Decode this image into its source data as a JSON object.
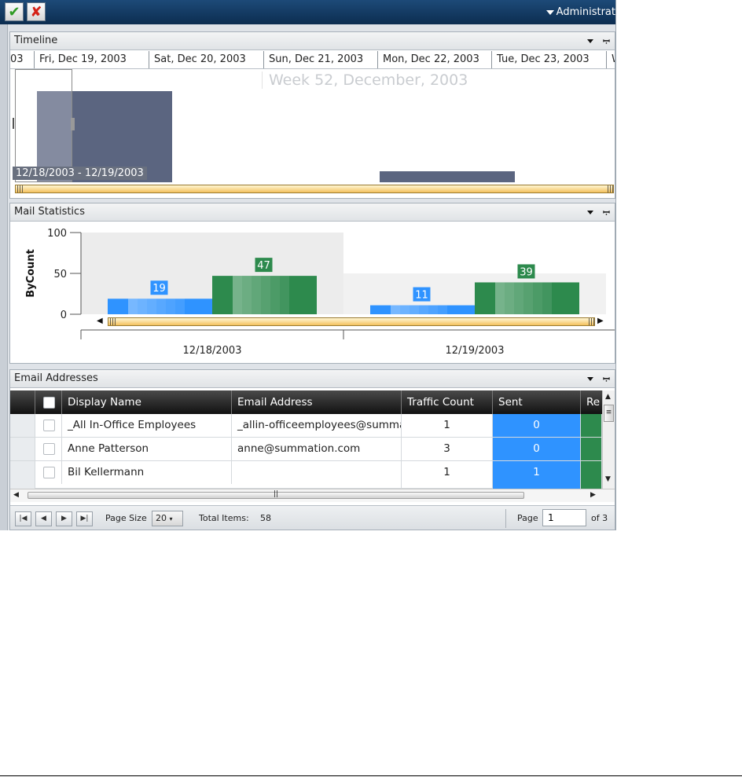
{
  "toolbar": {
    "ok_icon": "check-icon",
    "cancel_icon": "x-icon",
    "admin_menu_label": "Administrat"
  },
  "timeline": {
    "title": "Timeline",
    "days": [
      "03",
      "Fri, Dec 19, 2003",
      "Sat, Dec 20, 2003",
      "Sun, Dec 21, 2003",
      "Mon, Dec 22, 2003",
      "Tue, Dec 23, 2003",
      "W"
    ],
    "week_label": "Week 52, December, 2003",
    "selected_range": "12/18/2003 - 12/19/2003",
    "block_color": "#5b6580"
  },
  "mail_stats": {
    "title": "Mail Statistics"
  },
  "chart_data": {
    "type": "bar",
    "categories": [
      "12/18/2003",
      "12/19/2003"
    ],
    "series": [
      {
        "values": [
          19,
          11
        ],
        "color": "#2f93ff"
      },
      {
        "values": [
          47,
          39
        ],
        "color": "#2d8a4d"
      }
    ],
    "ylabel": "ByCount",
    "ylim": [
      0,
      100
    ],
    "yticks": [
      0,
      50,
      100
    ],
    "data_labels": true,
    "legend": "none"
  },
  "email": {
    "title": "Email Addresses",
    "columns": [
      "Display Name",
      "Email Address",
      "Traffic Count",
      "Sent",
      "Re"
    ],
    "rows": [
      {
        "name": "_All In-Office Employees",
        "email": "_allin-officeemployees@summa",
        "traffic": "1",
        "sent": "0"
      },
      {
        "name": "Anne Patterson",
        "email": "anne@summation.com",
        "traffic": "3",
        "sent": "0"
      },
      {
        "name": "Bil Kellermann",
        "email": "",
        "traffic": "1",
        "sent": "1"
      }
    ],
    "pager": {
      "page_size_label": "Page Size",
      "page_size": "20",
      "total_items_label": "Total Items:",
      "total_items": "58",
      "page_label": "Page",
      "page_value": "1",
      "page_of": "of 3"
    }
  },
  "colors": {
    "toolbar": "#0c2d50",
    "sent": "#2f93ff",
    "received": "#2d8a4d",
    "scroll_thumb": "#f4c25f"
  }
}
